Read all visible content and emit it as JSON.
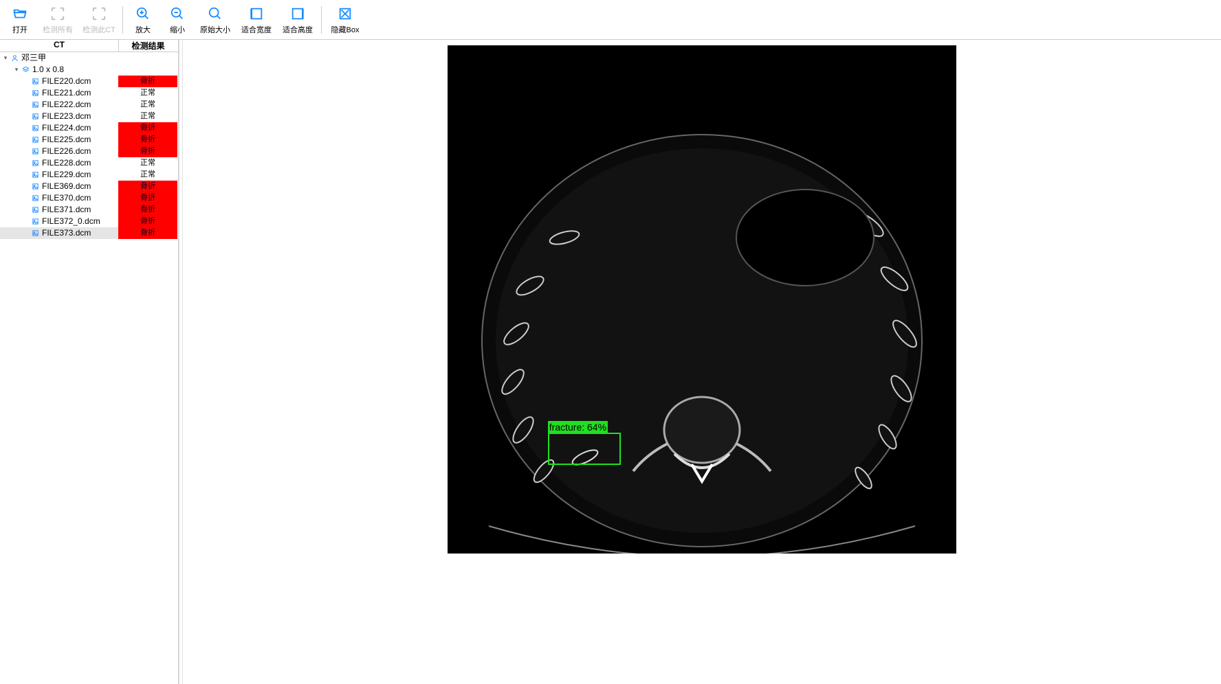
{
  "toolbar": {
    "open": "打开",
    "detect_all": "检测所有",
    "detect_this_ct": "检测此CT",
    "zoom_in": "放大",
    "zoom_out": "缩小",
    "original_size": "原始大小",
    "fit_width": "适合宽度",
    "fit_height": "适合高度",
    "hide_box": "隐藏Box"
  },
  "headers": {
    "ct": "CT",
    "result": "检测结果"
  },
  "tree": {
    "patient": "邓三甲",
    "series": "1.0 x 0.8",
    "result_labels": {
      "normal": "正常",
      "fracture": "骨折"
    },
    "files": [
      {
        "name": "FILE220.dcm",
        "result": "fracture"
      },
      {
        "name": "FILE221.dcm",
        "result": "normal"
      },
      {
        "name": "FILE222.dcm",
        "result": "normal"
      },
      {
        "name": "FILE223.dcm",
        "result": "normal"
      },
      {
        "name": "FILE224.dcm",
        "result": "fracture"
      },
      {
        "name": "FILE225.dcm",
        "result": "fracture"
      },
      {
        "name": "FILE226.dcm",
        "result": "fracture"
      },
      {
        "name": "FILE228.dcm",
        "result": "normal"
      },
      {
        "name": "FILE229.dcm",
        "result": "normal"
      },
      {
        "name": "FILE369.dcm",
        "result": "fracture"
      },
      {
        "name": "FILE370.dcm",
        "result": "fracture"
      },
      {
        "name": "FILE371.dcm",
        "result": "fracture"
      },
      {
        "name": "FILE372_0.dcm",
        "result": "fracture"
      },
      {
        "name": "FILE373.dcm",
        "result": "fracture",
        "selected": true
      }
    ]
  },
  "detection": {
    "label": "fracture: 64%",
    "box": {
      "left_pct": 19.7,
      "top_pct": 76.2,
      "width_pct": 14.3,
      "height_pct": 6.4
    }
  }
}
